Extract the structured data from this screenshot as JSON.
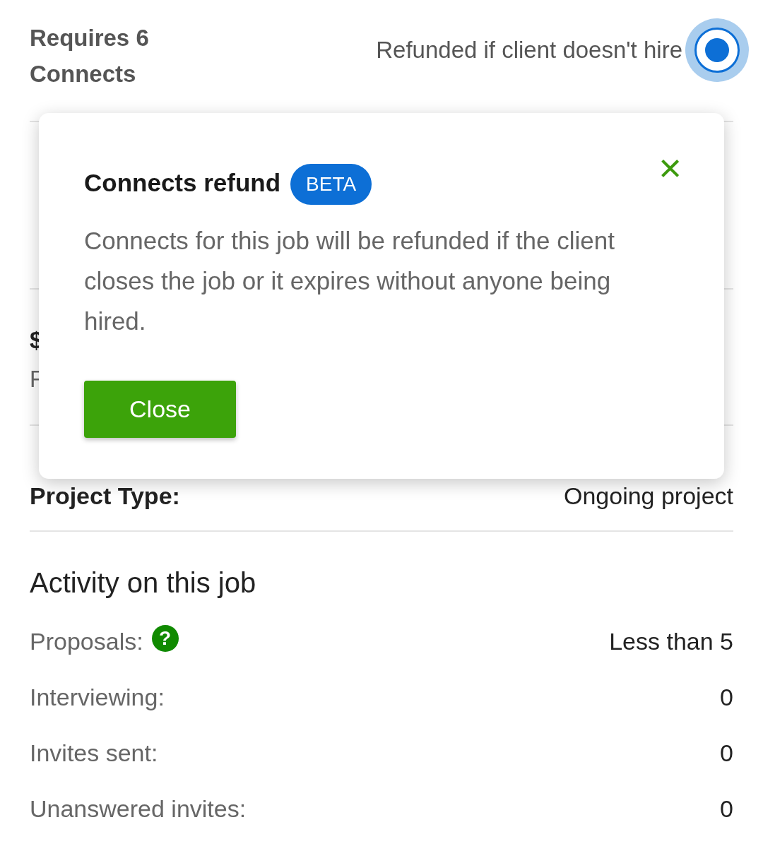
{
  "connects": {
    "requirement": "Requires 6 Connects",
    "refund_label": "Refunded if client doesn't hire",
    "refund_selected": true
  },
  "covered_rows": [
    {
      "lines": [
        "$",
        "F"
      ],
      "kind": "price"
    }
  ],
  "project_type": {
    "label": "Project Type:",
    "value": "Ongoing project"
  },
  "dialog": {
    "title": "Connects refund",
    "badge": "BETA",
    "close_icon": "×",
    "body": "Connects for this job will be refunded if the client closes the job or it expires without anyone being hired.",
    "button": "Close"
  },
  "activity": {
    "title": "Activity on this job",
    "rows": [
      {
        "label": "Proposals:",
        "value": "Less than 5",
        "help": "?"
      },
      {
        "label": "Interviewing:",
        "value": "0"
      },
      {
        "label": "Invites sent:",
        "value": "0"
      },
      {
        "label": "Unanswered invites:",
        "value": "0"
      }
    ]
  }
}
